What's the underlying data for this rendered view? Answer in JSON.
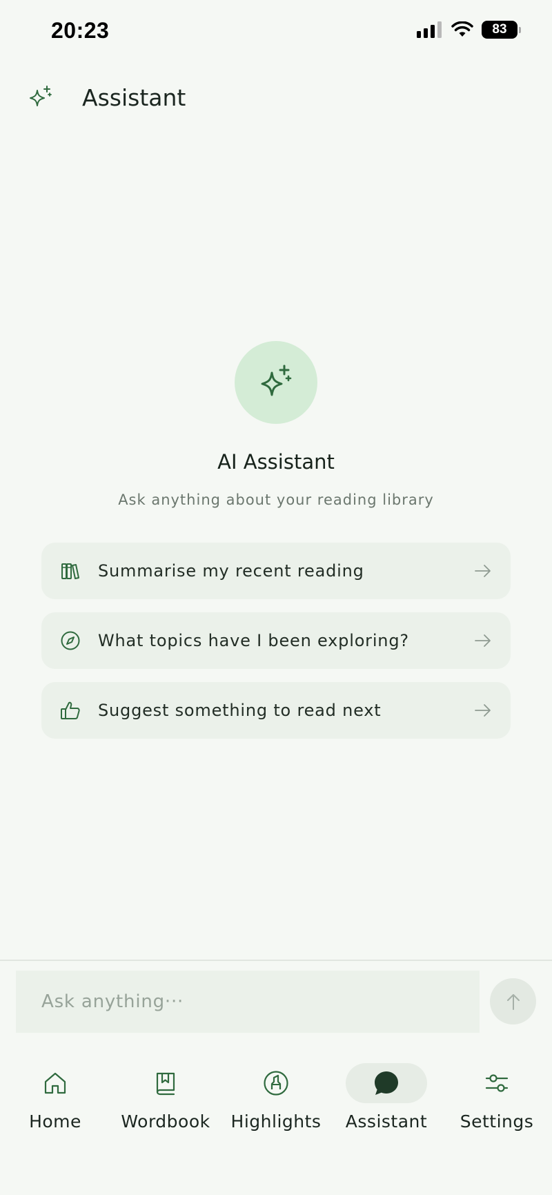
{
  "status_bar": {
    "time": "20:23",
    "battery": "83",
    "icons": [
      "cellular-signal-icon",
      "wifi-icon",
      "battery-icon"
    ]
  },
  "header": {
    "title": "Assistant",
    "icon": "sparkle-icon"
  },
  "hero": {
    "icon": "sparkle-icon",
    "title": "AI Assistant",
    "subtitle": "Ask anything about your reading library"
  },
  "suggestions": [
    {
      "icon": "books-icon",
      "label": "Summarise my recent reading"
    },
    {
      "icon": "compass-icon",
      "label": "What topics have I been exploring?"
    },
    {
      "icon": "thumbs-up-icon",
      "label": "Suggest something to read next"
    }
  ],
  "input": {
    "placeholder": "Ask anything···",
    "value": ""
  },
  "nav": {
    "items": [
      {
        "label": "Home",
        "icon": "home-icon",
        "active": false
      },
      {
        "label": "Wordbook",
        "icon": "bookmark-book-icon",
        "active": false
      },
      {
        "label": "Highlights",
        "icon": "highlighter-icon",
        "active": false
      },
      {
        "label": "Assistant",
        "icon": "chat-bubble-icon",
        "active": true
      },
      {
        "label": "Settings",
        "icon": "sliders-icon",
        "active": false
      }
    ]
  },
  "colors": {
    "background": "#f5f8f4",
    "accent": "#2f6a3e",
    "card": "#ebf1ea",
    "hero_circle": "#d4ecd6"
  }
}
